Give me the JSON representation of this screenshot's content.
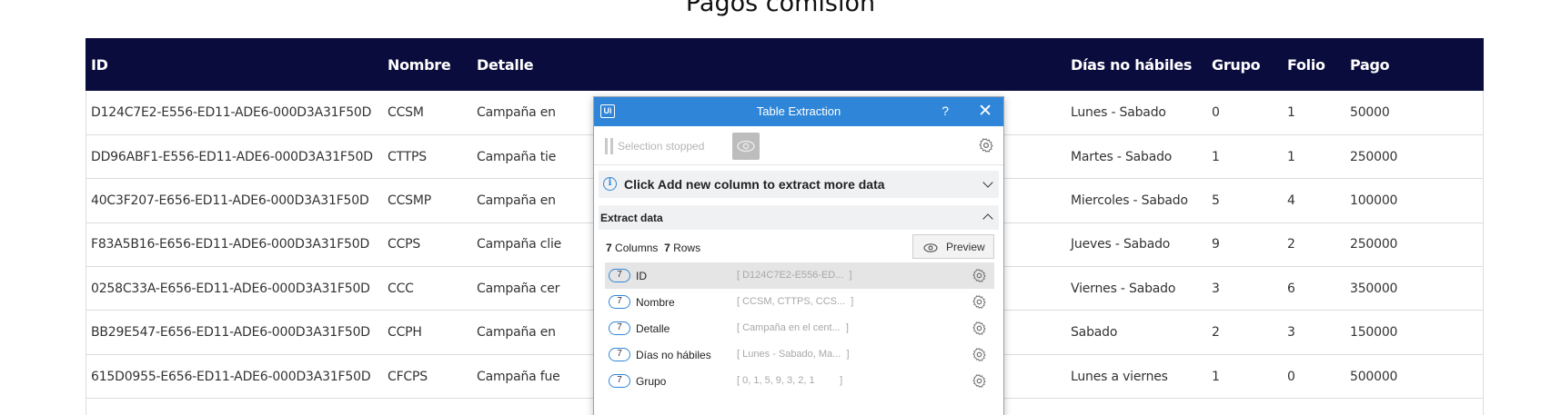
{
  "page": {
    "title": "Pagos comisión"
  },
  "table": {
    "headers": [
      "ID",
      "Nombre",
      "Detalle",
      "Días no hábiles",
      "Grupo",
      "Folio",
      "Pago"
    ],
    "rows": [
      [
        "D124C7E2-E556-ED11-ADE6-000D3A31F50D",
        "CCSM",
        "Campaña en",
        "Lunes - Sabado",
        "0",
        "1",
        "50000"
      ],
      [
        "DD96ABF1-E556-ED11-ADE6-000D3A31F50D",
        "CTTPS",
        "Campaña tie",
        "Martes - Sabado",
        "1",
        "1",
        "250000"
      ],
      [
        "40C3F207-E656-ED11-ADE6-000D3A31F50D",
        "CCSMP",
        "Campaña en",
        "Miercoles - Sabado",
        "5",
        "4",
        "100000"
      ],
      [
        "F83A5B16-E656-ED11-ADE6-000D3A31F50D",
        "CCPS",
        "Campaña clie",
        "Jueves - Sabado",
        "9",
        "2",
        "250000"
      ],
      [
        "0258C33A-E656-ED11-ADE6-000D3A31F50D",
        "CCC",
        "Campaña cer",
        "Viernes - Sabado",
        "3",
        "6",
        "350000"
      ],
      [
        "BB29E547-E656-ED11-ADE6-000D3A31F50D",
        "CCPH",
        "Campaña en",
        "Sabado",
        "2",
        "3",
        "150000"
      ],
      [
        "615D0955-E656-ED11-ADE6-000D3A31F50D",
        "CFCPS",
        "Campaña fue",
        "Lunes a viernes",
        "1",
        "0",
        "500000"
      ]
    ]
  },
  "dialog": {
    "logo": "Ui",
    "title": "Table Extraction",
    "help": "?",
    "close": "✕",
    "selection_status": "Selection stopped",
    "info_message": "Click Add new column to extract more data",
    "section_title": "Extract data",
    "columns_count": "7",
    "columns_label": "Columns",
    "rows_count": "7",
    "rows_label": "Rows",
    "preview_label": "Preview",
    "columns": [
      {
        "count": "7",
        "name": "ID",
        "sample": "[ D124C7E2-E556-ED...  ]"
      },
      {
        "count": "7",
        "name": "Nombre",
        "sample": "[ CCSM, CTTPS, CCS...  ]"
      },
      {
        "count": "7",
        "name": "Detalle",
        "sample": "[ Campaña en el cent...  ]"
      },
      {
        "count": "7",
        "name": "Días no hábiles",
        "sample": "[ Lunes - Sabado, Ma...  ]"
      },
      {
        "count": "7",
        "name": "Grupo",
        "sample": "[ 0, 1, 5, 9, 3, 2, 1         ]"
      }
    ],
    "colors": {
      "titlebar": "#2f86d8",
      "header": "#0b0c3e"
    }
  }
}
